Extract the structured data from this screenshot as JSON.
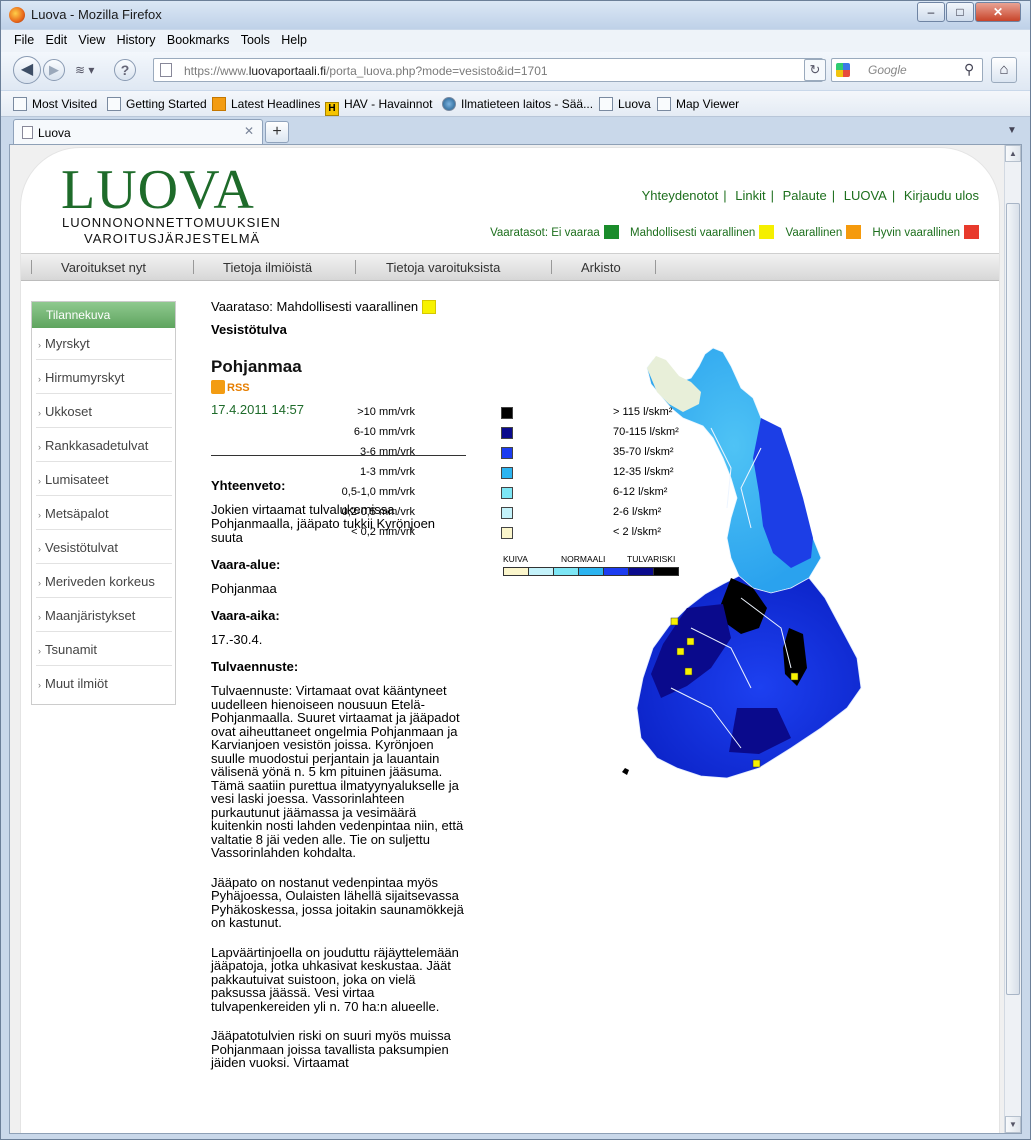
{
  "window": {
    "title": "Luova - Mozilla Firefox",
    "min": "–",
    "max": "□",
    "close": "✕"
  },
  "menu": [
    "File",
    "Edit",
    "View",
    "History",
    "Bookmarks",
    "Tools",
    "Help"
  ],
  "nav": {
    "url_prefix": "https://www.",
    "url_host": "luovaportaali.fi",
    "url_path": "/porta_luova.php?mode=vesisto&id=1701",
    "search_placeholder": "Google"
  },
  "bookmarks": [
    "Most Visited",
    "Getting Started",
    "Latest Headlines",
    "HAV - Havainnot",
    "Ilmatieteen laitos - Sää...",
    "Luova",
    "Map Viewer"
  ],
  "tab": {
    "label": "Luova"
  },
  "site": {
    "logo": "LUOVA",
    "logo_sub1": "LUONNONONNETTOMUUKSIEN",
    "logo_sub2": "VAROITUSJÄRJESTELMÄ",
    "toplinks": [
      "Yhteydenotot",
      "Linkit",
      "Palaute",
      "LUOVA",
      "Kirjaudu ulos"
    ],
    "levels_label": "Vaaratasot:",
    "levels": [
      {
        "label": "Ei vaaraa",
        "color": "#1a8c2b"
      },
      {
        "label": "Mahdollisesti vaarallinen",
        "color": "#f5ef00"
      },
      {
        "label": "Vaarallinen",
        "color": "#f59a0c"
      },
      {
        "label": "Hyvin vaarallinen",
        "color": "#e83a2c"
      }
    ],
    "mainnav": [
      "Varoitukset nyt",
      "Tietoja ilmiöistä",
      "Tietoja varoituksista",
      "Arkisto"
    ]
  },
  "sidebar": {
    "title": "Tilannekuva",
    "items": [
      "Myrskyt",
      "Hirmumyrskyt",
      "Ukkoset",
      "Rankkasadetulvat",
      "Lumisateet",
      "Metsäpalot",
      "Vesistötulvat",
      "Meriveden korkeus",
      "Maanjäristykset",
      "Tsunamit",
      "Muut ilmiöt"
    ]
  },
  "article": {
    "level": "Vaarataso: Mahdollisesti vaarallinen",
    "subject": "Vesistötulva",
    "region": "Pohjanmaa",
    "rss": "RSS",
    "date": "17.4.2011 14:57",
    "summary_label": "Yhteenveto:",
    "summary": "Jokien virtaamat tulvalukemissa Pohjanmaalla, jääpato tukkii Kyrönjoen suuta",
    "area_label": "Vaara-alue:",
    "area": "Pohjanmaa",
    "time_label": "Vaara-aika:",
    "time": "17.-30.4.",
    "forecast_label": "Tulvaennuste:",
    "p1": "Tulvaennuste: Virtamaat ovat kääntyneet uudelleen hienoiseen nousuun Etelä-Pohjanmaalla. Suuret virtaamat ja jääpadot ovat aiheuttaneet ongelmia Pohjanmaan ja Karvianjoen vesistön joissa. Kyrönjoen suulle muodostui perjantain ja lauantain välisenä yönä n. 5 km pituinen jääsuma. Tämä saatiin purettua ilmatyynyalukselle ja vesi laski joessa. Vassorinlahteen purkautunut jäämassa ja vesimäärä kuitenkin nosti lahden vedenpintaa niin, että valtatie 8 jäi veden alle. Tie on suljettu Vassorinlahden kohdalta.",
    "p2": "Jääpato on nostanut vedenpintaa myös Pyhäjoessa, Oulaisten lähellä sijaitsevassa Pyhäkoskessa, jossa joitakin saunamökkejä on kastunut.",
    "p3": "Lapväärtinjoella on jouduttu räjäyttelemään jääpatoja, jotka uhkasivat keskustaa. Jäät pakkautuivat suistoon, joka on vielä paksussa jäässä. Vesi virtaa tulvapenkereiden yli n. 70 ha:n alueelle.",
    "p4": "Jääpatotulvien riski on suuri myös muissa Pohjanmaan joissa tavallista paksumpien jäiden vuoksi. Virtaamat"
  },
  "legend": [
    {
      "a": ">10 mm/vrk",
      "b": "> 115 l/skm²",
      "color": "#000000"
    },
    {
      "a": "6-10 mm/vrk",
      "b": "70-115 l/skm²",
      "color": "#0a0a8c"
    },
    {
      "a": "3-6 mm/vrk",
      "b": "35-70 l/skm²",
      "color": "#1c3cf0"
    },
    {
      "a": "1-3 mm/vrk",
      "b": "12-35 l/skm²",
      "color": "#2cb4f0"
    },
    {
      "a": "0,5-1,0 mm/vrk",
      "b": "6-12 l/skm²",
      "color": "#7de6f5"
    },
    {
      "a": "0,2-0,5 mm/vrk",
      "b": "2-6 l/skm²",
      "color": "#c4f2fa"
    },
    {
      "a": "< 0,2 mm/vrk",
      "b": "< 2 l/skm²",
      "color": "#fbf6cc"
    }
  ],
  "scale": {
    "labels": [
      "KUIVA",
      "NORMAALI",
      "TULVARISKI"
    ],
    "colors": [
      "#fbf6cc",
      "#c4f2fa",
      "#7de6f5",
      "#2cb4f0",
      "#1c3cf0",
      "#0a0a8c",
      "#000000"
    ]
  }
}
